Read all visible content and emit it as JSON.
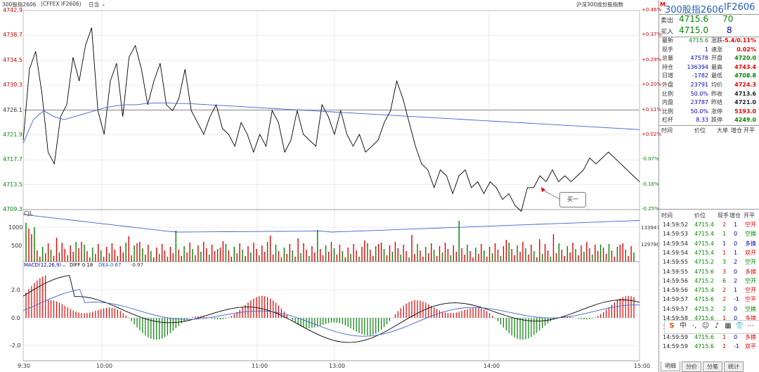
{
  "topbar": {
    "title": "300股指2606",
    "code": "(CFFEX IF2606)",
    "period": "日当",
    "reference": "沪深300成份股指数"
  },
  "price_axis": [
    "4742.9",
    "4738.7",
    "4734.5",
    "4730.3",
    "4726.1",
    "4721.9",
    "4717.7",
    "4713.5",
    "4709.3"
  ],
  "pct_axis": [
    "+0.46%",
    "+0.37%",
    "+0.29%",
    "+0.20%",
    "+0.11%",
    "+0.02%",
    "-0.07%",
    "-0.16%",
    "-0.25%"
  ],
  "price_line": [
    4721,
    4733,
    4736,
    4729,
    4719,
    4717,
    4725,
    4727,
    4735,
    4731,
    4737,
    4740,
    4726,
    4722,
    4731,
    4734,
    4725,
    4735,
    4737,
    4733,
    4727,
    4731,
    4734,
    4727,
    4726,
    4728,
    4733,
    4726,
    4724,
    4722,
    4725,
    4727,
    4723,
    4722,
    4720,
    4724,
    4722,
    4719,
    4722,
    4720,
    4726,
    4724,
    4719,
    4721,
    4726,
    4722,
    4721,
    4720,
    4727,
    4725,
    4722,
    4726,
    4722,
    4720,
    4722,
    4719,
    4720,
    4721,
    4724,
    4726,
    4731,
    4728,
    4724,
    4720,
    4717,
    4716,
    4713,
    4716,
    4715,
    4712,
    4715,
    4716,
    4713,
    4714,
    4712,
    4714,
    4713,
    4711,
    4712,
    4710,
    4709,
    4713,
    4713,
    4715,
    4714,
    4716,
    4714,
    4715,
    4714,
    4715,
    4716,
    4718,
    4717,
    4718,
    4719,
    4718,
    4717,
    4716,
    4715,
    4714
  ],
  "avg_line": [
    4720.5,
    4724.5,
    4726.0,
    4725.0,
    4724.5,
    4725.0,
    4725.5,
    4726.0,
    4726.5,
    4726.8,
    4727.0,
    4727.0,
    4727.2,
    4727.3,
    4727.3,
    4727.2,
    4727.2,
    4727.1,
    4727.0,
    4726.9,
    4726.8,
    4726.7,
    4726.6,
    4726.5,
    4726.4,
    4726.3,
    4726.2,
    4726.1,
    4726.0,
    4725.9,
    4725.8,
    4725.7,
    4725.6,
    4725.5,
    4725.4,
    4725.3,
    4725.2,
    4725.1,
    4725.0,
    4724.9,
    4724.8,
    4724.7,
    4724.6,
    4724.5,
    4724.4,
    4724.3,
    4724.2,
    4724.1,
    4724.0,
    4723.9,
    4723.8,
    4723.7,
    4723.6,
    4723.5,
    4723.4,
    4723.3,
    4723.2,
    4723.1,
    4723.0,
    4722.9,
    4722.8
  ],
  "annotation": "买一",
  "vol_panel": {
    "label": "CJL",
    "ticks": [
      "1000",
      "500"
    ],
    "right_ticks": [
      "133947",
      "129780"
    ]
  },
  "macd_panel": {
    "label": "MACD(12,26,9)",
    "diff_label": "DIFF 0.18",
    "dea_label": "DEA 0.67",
    "macd_value": "-0.97",
    "ticks": [
      "2.0",
      "0.0",
      "-2.0"
    ]
  },
  "time_axis": [
    "9:30",
    "10:00",
    "11:00",
    "13:00",
    "14:00",
    "15:00"
  ],
  "quote": {
    "name": "300股指2606",
    "code": "IF2606",
    "marker": "M",
    "sell_label": "卖出",
    "sell_price": "4715.6",
    "sell_vol": "70",
    "buy_label": "买入",
    "buy_price": "4715.0",
    "buy_vol": "8",
    "rows": [
      {
        "l1": "最新",
        "v1": "4715.6",
        "c1": "green",
        "l2": "涨跌",
        "v2": "-5.4/0.11%",
        "c2": "red"
      },
      {
        "l1": "现手",
        "v1": "1",
        "c1": "blue",
        "l2": "速涨",
        "v2": "0.02%",
        "c2": "red"
      },
      {
        "l1": "总量",
        "v1": "47578",
        "c1": "blue",
        "l2": "开盘",
        "v2": "4720.0",
        "c2": "green"
      },
      {
        "l1": "持仓",
        "v1": "136394",
        "c1": "blue",
        "l2": "最高",
        "v2": "4743.4",
        "c2": "red"
      },
      {
        "l1": "日增",
        "v1": "-1782",
        "c1": "blue",
        "l2": "最低",
        "v2": "4708.8",
        "c2": "green"
      },
      {
        "l1": "外盘",
        "v1": "23791",
        "c1": "blue",
        "l2": "均价",
        "v2": "4724.3",
        "c2": "red"
      },
      {
        "l1": "比例",
        "v1": "50.0%",
        "c1": "blue",
        "l2": "昨收",
        "v2": "4713.6",
        "c2": "black"
      },
      {
        "l1": "内盘",
        "v1": "23787",
        "c1": "blue",
        "l2": "昨结",
        "v2": "4721.0",
        "c2": "black"
      },
      {
        "l1": "比例",
        "v1": "50.0%",
        "c1": "blue",
        "l2": "涨停",
        "v2": "5193.0",
        "c2": "red"
      },
      {
        "l1": "杠杆",
        "v1": "8.33",
        "c1": "blue",
        "l2": "跌停",
        "v2": "4249.0",
        "c2": "green"
      }
    ],
    "cols1": [
      "时间",
      "价位",
      "大单",
      "增仓",
      "开平"
    ]
  },
  "trades": {
    "headers": [
      "时间",
      "价位",
      "现手",
      "增仓",
      "开平"
    ],
    "rows": [
      [
        "14:59:52",
        "4715.4",
        "2",
        "1",
        "空开",
        "red"
      ],
      [
        "14:59:53",
        "4715.4",
        "1",
        "0",
        "空换",
        "green"
      ],
      [
        "14:59:54",
        "4715.4",
        "1",
        "0",
        "多换",
        "blue"
      ],
      [
        "14:59:54",
        "4715.4",
        "1",
        "1",
        "双开",
        "red"
      ],
      [
        "14:59:55",
        "4715.2",
        "3",
        "2",
        "空开",
        "green"
      ],
      [
        "14:59:55",
        "4715.6",
        "3",
        "0",
        "多换",
        "red"
      ],
      [
        "14:59:56",
        "4715.2",
        "6",
        "2",
        "空开",
        "green"
      ],
      [
        "14:59:56",
        "4715.4",
        "2",
        "1",
        "空开",
        "red"
      ],
      [
        "14:59:57",
        "4715.6",
        "2",
        "-1",
        "空平",
        "red"
      ],
      [
        "14:59:57",
        "4715.2",
        "2",
        "0",
        "空换",
        "green"
      ],
      [
        "14:59:58",
        "4715.6",
        "1",
        "0",
        "多换",
        "red"
      ],
      [
        "14:59:58",
        "4715.4",
        "1",
        "0",
        "多换",
        "green"
      ],
      [
        "14:59:59",
        "4715.6",
        "1",
        "0",
        "多换",
        "red"
      ],
      [
        "14:59:59",
        "4715.6",
        "1",
        "-1",
        "双平",
        "red"
      ]
    ]
  },
  "toolbar": {
    "items": [
      "S",
      "中",
      "·,",
      "☺",
      "♪",
      "▦",
      "👕",
      "⋯"
    ]
  },
  "tabs": [
    "明细",
    "分价",
    "分笔",
    "统计"
  ],
  "colors": {
    "up": "#e00000",
    "down": "#008000",
    "line": "#000000",
    "avg": "#4060d0",
    "grid": "#d8d8d8"
  }
}
